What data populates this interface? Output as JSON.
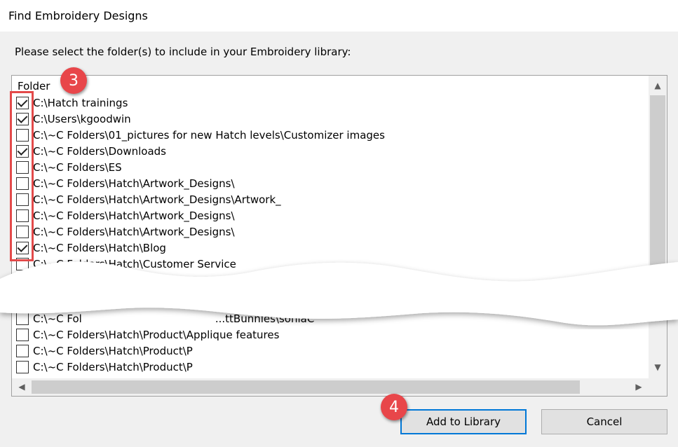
{
  "window": {
    "title": "Find Embroidery Designs"
  },
  "dialog": {
    "instruction": "Please select the folder(s) to include in your Embroidery library:",
    "column_header": "Folder",
    "folders_top": [
      {
        "path": "C:\\Hatch trainings",
        "checked": true
      },
      {
        "path": "C:\\Users\\kgoodwin",
        "checked": true
      },
      {
        "path": "C:\\~C Folders\\01_pictures for new Hatch levels\\Customizer images",
        "checked": false
      },
      {
        "path": "C:\\~C Folders\\Downloads",
        "checked": true
      },
      {
        "path": "C:\\~C Folders\\ES",
        "checked": false
      },
      {
        "path": "C:\\~C Folders\\Hatch\\Artwork_Designs\\",
        "checked": false
      },
      {
        "path": "C:\\~C Folders\\Hatch\\Artwork_Designs\\Artwork_",
        "checked": false
      },
      {
        "path": "C:\\~C Folders\\Hatch\\Artwork_Designs\\",
        "checked": false
      },
      {
        "path": "C:\\~C Folders\\Hatch\\Artwork_Designs\\",
        "checked": false
      },
      {
        "path": "C:\\~C Folders\\Hatch\\Blog",
        "checked": true
      },
      {
        "path": "C:\\~C Folders\\Hatch\\Customer Service",
        "checked": false
      }
    ],
    "folders_bottom": [
      {
        "path": "C:\\~C Fol",
        "suffix": "...ttBunnies\\soniaC",
        "checked": false
      },
      {
        "path": "C:\\~C Folders\\Hatch\\Product\\Applique features",
        "checked": false
      },
      {
        "path": "C:\\~C Folders\\Hatch\\Product\\P",
        "checked": false
      },
      {
        "path": "C:\\~C Folders\\Hatch\\Product\\P",
        "checked": false
      }
    ],
    "add_button_label": "Add to Library",
    "cancel_button_label": "Cancel"
  },
  "annotations": {
    "step_checkboxes": "3",
    "step_add": "4"
  },
  "colors": {
    "badge": "#e8464a",
    "highlight_box": "#e34a4a",
    "primary_border": "#0078d7"
  }
}
